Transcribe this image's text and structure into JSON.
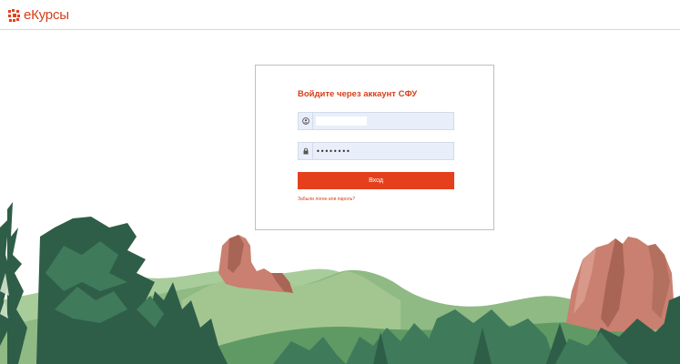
{
  "header": {
    "logo_text": "eКурсы",
    "logo_icon": "ekursy-logo-icon"
  },
  "login": {
    "title": "Войдите через аккаунт СФУ",
    "username": {
      "value": "",
      "icon": "user-icon"
    },
    "password": {
      "value": "••••••••",
      "icon": "lock-icon"
    },
    "submit_label": "Вход",
    "forgot_label": "Забыли логин или пароль?"
  },
  "colors": {
    "accent": "#e5401c",
    "brand_text": "#d5401a",
    "field_bg": "#e8effb",
    "hill_light": "#8fba84",
    "hill_mid": "#5f9a64",
    "tree_dark": "#2e5e48",
    "rock": "#c98070"
  }
}
